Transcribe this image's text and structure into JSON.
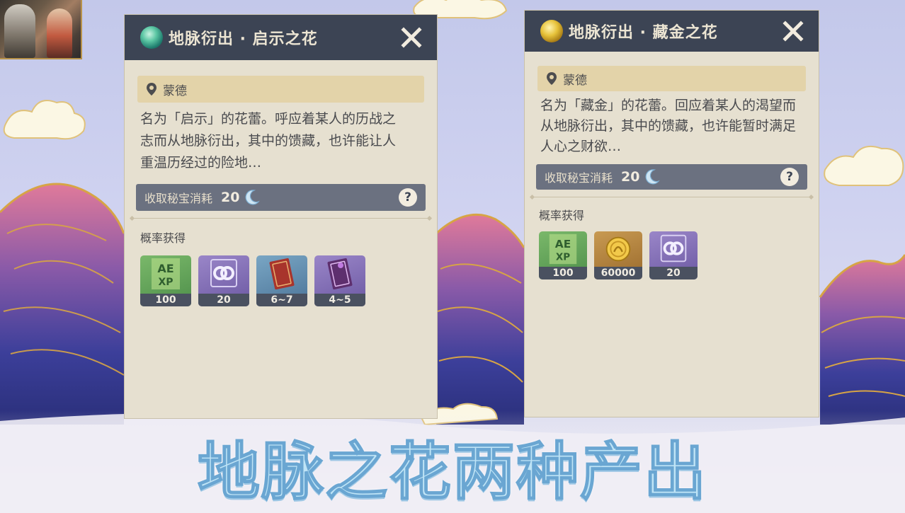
{
  "panels": [
    {
      "title": "地脉衍出 · 启示之花",
      "gem_color": "#5cc7a4",
      "icon": "ley-line-blossom-revelation-icon",
      "region": "蒙德",
      "description_lines": [
        "名为「启示」的花蕾。呼应着某人的历战之",
        "志而从地脉衍出，其中的馈藏，也许能让人",
        "重温历经过的险地…"
      ],
      "cost_label": "收取秘宝消耗",
      "cost_value": "20",
      "cost_icon": "original-resin-moon-icon",
      "help": "?",
      "drops_label": "概率获得",
      "drops": [
        {
          "icon": "adventure-exp-icon",
          "rarity": "green",
          "count": "100"
        },
        {
          "icon": "companionship-exp-icon",
          "rarity": "purple",
          "count": "20"
        },
        {
          "icon": "adventurers-experience-book-icon",
          "rarity": "blue",
          "count": "6~7"
        },
        {
          "icon": "heros-wit-book-icon",
          "rarity": "purple",
          "count": "4~5"
        }
      ]
    },
    {
      "title": "地脉衍出 · 藏金之花",
      "gem_color": "#e6c23a",
      "icon": "ley-line-blossom-wealth-icon",
      "region": "蒙德",
      "description_lines": [
        "名为「藏金」的花蕾。回应着某人的渴望而",
        "从地脉衍出，其中的馈藏，也许能暂时满足",
        "人心之财欲…"
      ],
      "cost_label": "收取秘宝消耗",
      "cost_value": "20",
      "cost_icon": "original-resin-moon-icon",
      "help": "?",
      "drops_label": "概率获得",
      "drops": [
        {
          "icon": "adventure-exp-icon",
          "rarity": "green",
          "count": "100"
        },
        {
          "icon": "mora-coin-icon",
          "rarity": "gold",
          "count": "60000"
        },
        {
          "icon": "companionship-exp-icon",
          "rarity": "purple",
          "count": "20"
        }
      ]
    }
  ],
  "caption": "地脉之花两种产出",
  "colors": {
    "header": "#3c4454",
    "panel_bg": "#e6e0d0",
    "region_bg": "#e3d3a9",
    "cost_bg": "#6b7180",
    "caption_fill": "#bfe4f6",
    "caption_stroke": "#6aa6d2"
  }
}
